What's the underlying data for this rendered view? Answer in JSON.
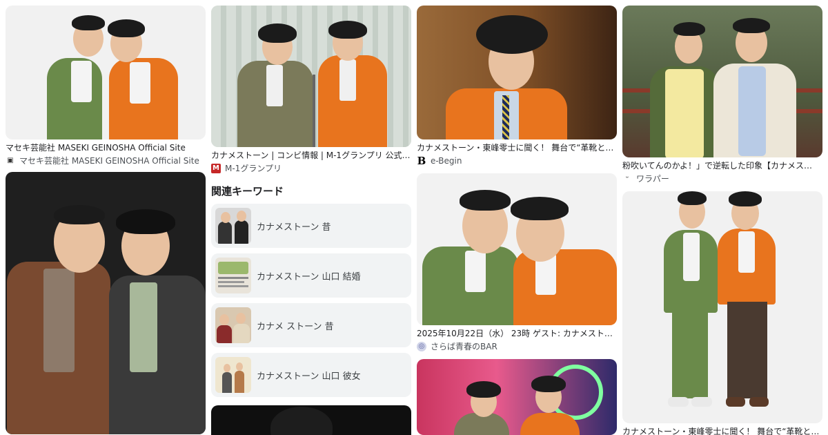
{
  "col1": {
    "card1": {
      "caption": "マセキ芸能社 MASEKI GEINOSHA Official Site",
      "source": "マセキ芸能社 MASEKI GEINOSHA Official Site",
      "bg": "#f2f2f2"
    },
    "card2": {
      "bg": "#2b2b2b"
    }
  },
  "col2": {
    "card1": {
      "caption": "カナメストーン | コンビ情報 | M-1グランプリ 公式…",
      "source": "M-1グランプリ",
      "bg": "#c9d3cc"
    },
    "keywords_title": "関連キーワード",
    "keywords": [
      {
        "label": "カナメストーン 昔"
      },
      {
        "label": "カナメストーン 山口 結婚"
      },
      {
        "label": "カナメ ストーン 昔"
      },
      {
        "label": "カナメストーン 山口 彼女"
      }
    ],
    "card2": {
      "bg": "#111111"
    }
  },
  "col3": {
    "card1": {
      "caption": "カナメストーン・東峰零士に聞く！ 舞台で“革靴と…",
      "source": "e-Begin",
      "bg": "#8b5a2b"
    },
    "card2": {
      "caption": "2025年10月22日（水） 23時 ゲスト: カナメストー…",
      "source": "さらば青春のBAR",
      "bg": "#f3f3f3"
    },
    "card3": {
      "bg": "#c03060"
    }
  },
  "col4": {
    "card1": {
      "caption": "粉吹いてんのかよ！」で逆転した印象【カナメス…",
      "source": "ワラパー",
      "bg": "#5d6b4a"
    },
    "card2": {
      "caption": "カナメストーン・東峰零士に聞く！ 舞台で“革靴と…",
      "bg": "#f3f3f3"
    }
  },
  "colors": {
    "green_jacket": "#6a8a4a",
    "orange_jacket": "#e8741e",
    "brown_jacket": "#7a4a30",
    "dark_jacket": "#3a3a3a",
    "cream_jacket": "#ece6d8"
  }
}
